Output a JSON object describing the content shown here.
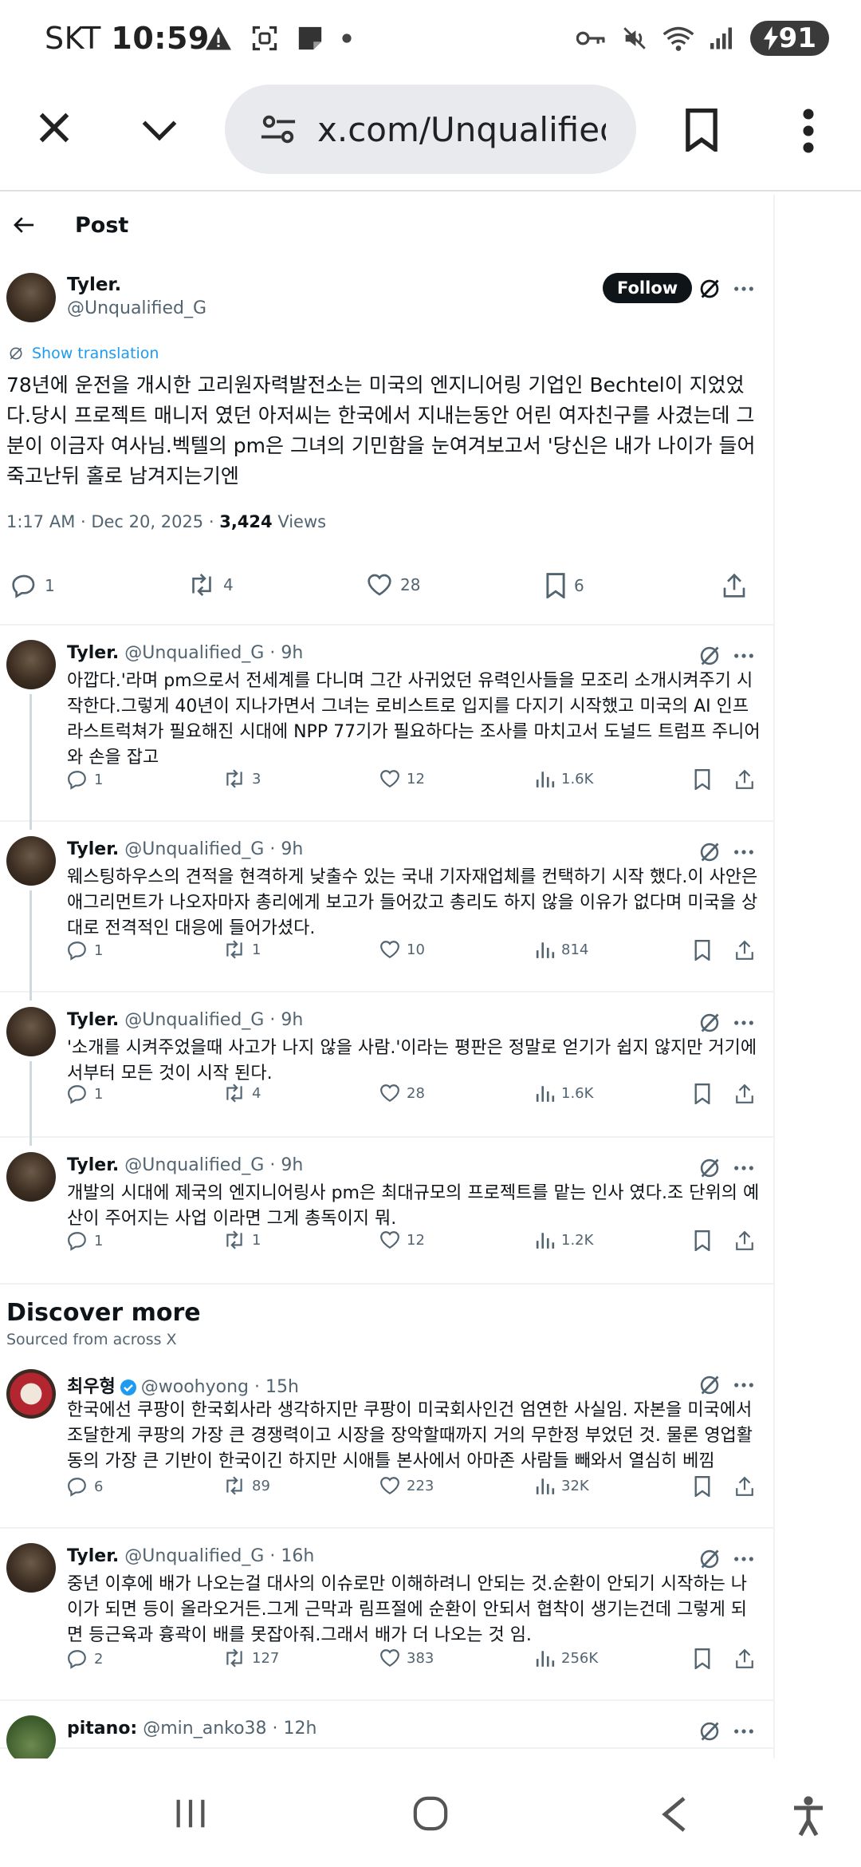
{
  "status_bar": {
    "carrier": "SKT",
    "time": "10:59",
    "battery": "91"
  },
  "browser": {
    "url": "x.com/Unqualified_G"
  },
  "page": {
    "back_icon": "arrow-left-icon",
    "title": "Post"
  },
  "main_post": {
    "name": "Tyler.",
    "handle": "@Unqualified_G",
    "follow_label": "Follow",
    "show_translation": "Show translation",
    "text": "78년에 운전을 개시한 고리원자력발전소는 미국의 엔지니어링 기업인 Bechtel이 지었었다.당시 프로젝트 매니저 였던 아저씨는 한국에서 지내는동안 어린 여자친구를 사겼는데 그 분이 이금자 여사님.벡텔의 pm은 그녀의 기민함을 눈여겨보고서 '당신은 내가 나이가 들어 죽고난뒤 홀로 남겨지는기엔",
    "time": "1:17 AM · Dec 20, 2025 · ",
    "views_count": "3,424",
    "views_label": " Views",
    "replies": "1",
    "reposts": "4",
    "likes": "28",
    "bookmarks": "6"
  },
  "replies": [
    {
      "name": "Tyler.",
      "handle": "@Unqualified_G · 9h",
      "text": "아깝다.'라며 pm으로서 전세계를 다니며 그간 사귀었던 유력인사들을 모조리 소개시켜주기 시작한다.그렇게 40년이 지나가면서 그녀는 로비스트로 입지를 다지기 시작했고 미국의 AI 인프라스트럭쳐가 필요해진 시대에 NPP 77기가 필요하다는 조사를 마치고서 도널드 트럼프 주니어와 손을 잡고",
      "replies": "1",
      "reposts": "3",
      "likes": "12",
      "views": "1.6K"
    },
    {
      "name": "Tyler.",
      "handle": "@Unqualified_G · 9h",
      "text": "웨스팅하우스의 견적을 현격하게 낮출수 있는 국내 기자재업체를 컨택하기 시작 했다.이 사안은 애그리먼트가 나오자마자 총리에게 보고가 들어갔고 총리도 하지 않을 이유가 없다며 미국을 상대로 전격적인 대응에 들어가셨다.",
      "replies": "1",
      "reposts": "1",
      "likes": "10",
      "views": "814"
    },
    {
      "name": "Tyler.",
      "handle": "@Unqualified_G · 9h",
      "text": "'소개를 시켜주었을때 사고가 나지 않을 사람.'이라는 평판은 정말로 얻기가 쉽지 않지만 거기에서부터 모든 것이 시작 된다.",
      "replies": "1",
      "reposts": "4",
      "likes": "28",
      "views": "1.6K"
    },
    {
      "name": "Tyler.",
      "handle": "@Unqualified_G · 9h",
      "text": "개발의 시대에 제국의 엔지니어링사 pm은 최대규모의 프로젝트를 맡는 인사 였다.조 단위의 예산이 주어지는 사업 이라면 그게 총독이지 뭐.",
      "replies": "1",
      "reposts": "1",
      "likes": "12",
      "views": "1.2K"
    }
  ],
  "discover": {
    "title": "Discover more",
    "subtitle": "Sourced from across X"
  },
  "discover_posts": [
    {
      "name": "최우형",
      "handle": "@woohyong · 15h",
      "verified": true,
      "avatar": "santa",
      "text": "한국에선 쿠팡이 한국회사라 생각하지만 쿠팡이 미국회사인건 엄연한 사실임. 자본을 미국에서 조달한게 쿠팡의 가장 큰 경쟁력이고 시장을 장악할때까지 거의 무한정 부었던 것. 물론 영업활동의 가장 큰 기반이 한국이긴 하지만 시애틀 본사에서 아마존 사람들 빼와서 열심히 베낌",
      "replies": "6",
      "reposts": "89",
      "likes": "223",
      "views": "32K"
    },
    {
      "name": "Tyler.",
      "handle": "@Unqualified_G · 16h",
      "verified": false,
      "avatar": "tyler",
      "text": "중년 이후에 배가 나오는걸 대사의 이슈로만 이해하려니 안되는 것.순환이 안되기 시작하는 나이가 되면 등이 올라오거든.그게 근막과 림프절에 순환이 안되서 협착이 생기는건데 그렇게 되면 등근육과 흉곽이 배를 못잡아줘.그래서 배가 더 나오는 것 임.",
      "replies": "2",
      "reposts": "127",
      "likes": "383",
      "views": "256K"
    },
    {
      "name": "pitano:",
      "handle": "@min_anko38 · 12h",
      "verified": false,
      "avatar": "green",
      "text": ""
    }
  ]
}
